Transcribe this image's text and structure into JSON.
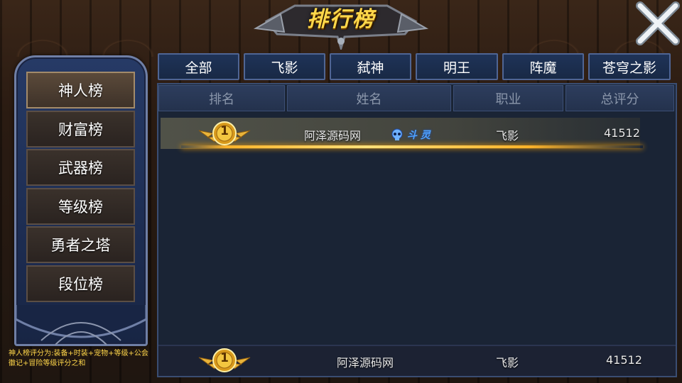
{
  "title": "排行榜",
  "top_tabs": [
    "全部",
    "飞影",
    "弑神",
    "明王",
    "阵魔",
    "苍穹之影"
  ],
  "side_tabs": [
    "神人榜",
    "财富榜",
    "武器榜",
    "等级榜",
    "勇者之塔",
    "段位榜"
  ],
  "columns": [
    "排名",
    "姓名",
    "职业",
    "总评分"
  ],
  "rows": [
    {
      "rank": "1",
      "name": "阿泽源码网",
      "title_tag": "斗 灵",
      "class": "飞影",
      "score": "41512"
    }
  ],
  "my_rank": {
    "rank": "1",
    "name": "阿泽源码网",
    "class": "飞影",
    "score": "41512"
  },
  "note": "神人榜评分为:装备+时装+宠物+等级+公会徽记+冒险等级评分之和",
  "colors": {
    "gold": "#ffd84a",
    "panel": "#1a2435",
    "tab_border": "#4f6594"
  }
}
